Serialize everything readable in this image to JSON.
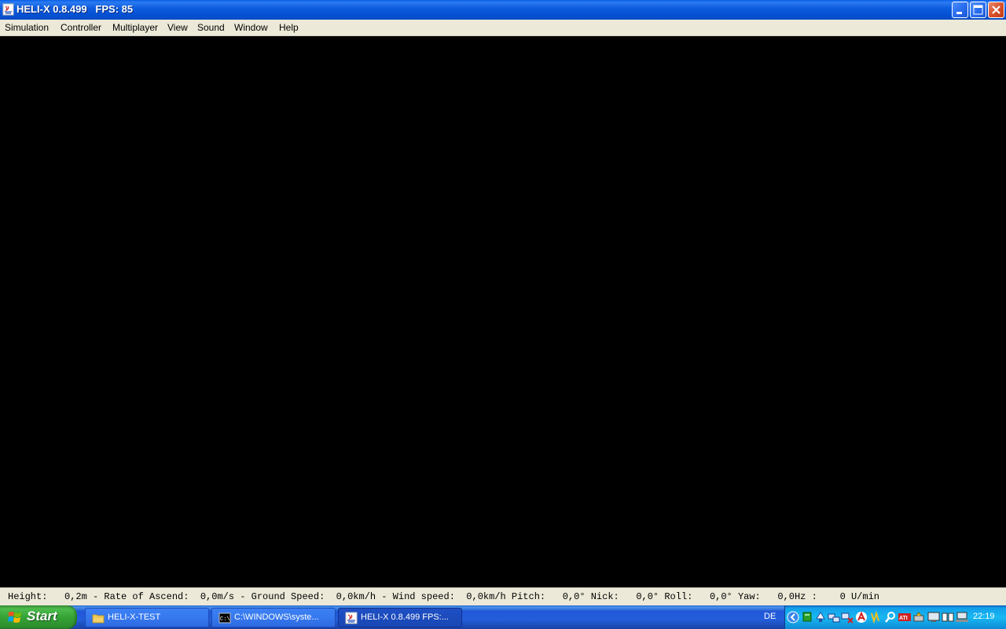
{
  "window": {
    "title": "HELI-X 0.8.499   FPS: 85"
  },
  "menu": {
    "items": [
      "Simulation",
      "Controller",
      "Multiplayer",
      "View",
      "Sound",
      "Window",
      "Help"
    ]
  },
  "status": {
    "text": "Height:   0,2m - Rate of Ascend:  0,0m/s - Ground Speed:  0,0km/h - Wind speed:  0,0km/h Pitch:   0,0° Nick:   0,0° Roll:   0,0° Yaw:   0,0Hz :    0 U/min"
  },
  "taskbar": {
    "start_label": "Start",
    "tasks": [
      {
        "label": "HELI-X-TEST",
        "icon": "folder-icon"
      },
      {
        "label": "C:\\WINDOWS\\syste...",
        "icon": "console-icon"
      },
      {
        "label": "HELI-X 0.8.499   FPS:...",
        "icon": "java-icon"
      }
    ],
    "language": "DE",
    "clock": "22:19"
  },
  "colors": {
    "titlebar": "#0a5fe8",
    "menubar": "#ece9d8",
    "viewport": "#000000",
    "taskbar": "#245edb",
    "start": "#35a335",
    "tray": "#18b9f2"
  }
}
